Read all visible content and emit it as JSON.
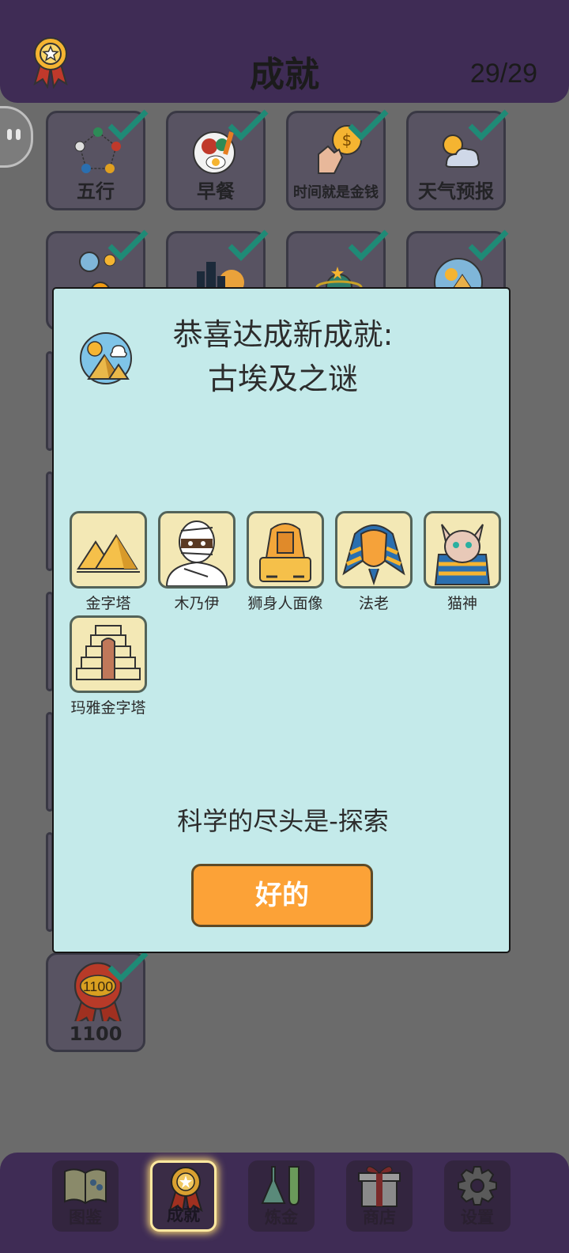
{
  "header": {
    "title": "成就",
    "count": "29/29"
  },
  "tiles": [
    {
      "label": "五行",
      "icon": "five-elements-icon"
    },
    {
      "label": "早餐",
      "icon": "breakfast-icon"
    },
    {
      "label": "时间就是金钱",
      "icon": "time-money-icon"
    },
    {
      "label": "天气预报",
      "icon": "weather-icon"
    },
    {
      "label": "",
      "icon": "weather-orange-icon"
    },
    {
      "label": "",
      "icon": "city-night-icon"
    },
    {
      "label": "",
      "icon": "planet-icon"
    },
    {
      "label": "",
      "icon": "pyramid-sun-icon"
    },
    {
      "label": "1100",
      "icon": "ribbon-1100-icon",
      "badge": "1100"
    }
  ],
  "modal": {
    "heading_line1": "恭喜达成新成就:",
    "heading_line2": "古埃及之谜",
    "items": [
      {
        "name": "金字塔",
        "icon": "pyramids-icon"
      },
      {
        "name": "木乃伊",
        "icon": "mummy-icon"
      },
      {
        "name": "狮身人面像",
        "icon": "sphinx-icon"
      },
      {
        "name": "法老",
        "icon": "pharaoh-icon"
      },
      {
        "name": "猫神",
        "icon": "cat-god-icon"
      },
      {
        "name": "玛雅金字塔",
        "icon": "mayan-pyramid-icon"
      }
    ],
    "motto": "科学的尽头是-探索",
    "ok_label": "好的"
  },
  "nav": [
    {
      "label": "图鉴",
      "icon": "book-icon",
      "active": false
    },
    {
      "label": "成就",
      "icon": "medal-icon",
      "active": true
    },
    {
      "label": "炼金",
      "icon": "flask-icon",
      "active": false
    },
    {
      "label": "商店",
      "icon": "gift-icon",
      "active": false
    },
    {
      "label": "设置",
      "icon": "gear-icon",
      "active": false
    }
  ],
  "colors": {
    "header_bg": "#3f2c55",
    "modal_bg": "#c4eaea",
    "button_orange": "#fca237",
    "check_green": "#1f8a76"
  }
}
